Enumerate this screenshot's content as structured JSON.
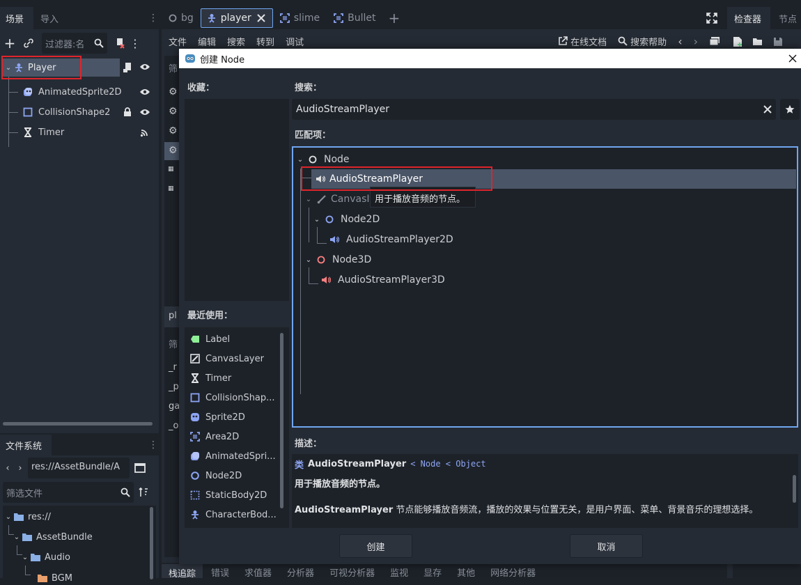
{
  "scene_panel": {
    "tabs": [
      "场景",
      "导入"
    ],
    "filter_placeholder": "过滤器:名",
    "nodes": [
      {
        "label": "Player"
      },
      {
        "label": "AnimatedSprite2D"
      },
      {
        "label": "CollisionShape2"
      },
      {
        "label": "Timer"
      }
    ]
  },
  "filesystem": {
    "title": "文件系统",
    "path": "res://AssetBundle/A",
    "filter_placeholder": "筛选文件",
    "items": [
      {
        "label": "res://"
      },
      {
        "label": "AssetBundle"
      },
      {
        "label": "Audio"
      },
      {
        "label": "BGM"
      }
    ]
  },
  "editor_tabs": [
    "bg",
    "player",
    "slime",
    "Bullet"
  ],
  "menu": {
    "items": [
      "文件",
      "编辑",
      "搜索",
      "转到",
      "调试"
    ],
    "online_docs": "在线文档",
    "search_help": "搜索帮助"
  },
  "right_tabs": [
    "检查器",
    "节点"
  ],
  "script_panel": {
    "filter_label": "筛",
    "partial_label": "pl",
    "filter_label2": "筛",
    "rows": [
      "_r",
      "_p",
      "ga",
      "_o"
    ]
  },
  "bottom_tabs": [
    "栈追踪",
    "错误",
    "求值器",
    "分析器",
    "可视分析器",
    "监视",
    "显存",
    "其他",
    "网络分析器"
  ],
  "dialog": {
    "title": "创建 Node",
    "favorites_label": "收藏：",
    "recent_label": "最近使用：",
    "recent_items": [
      "Label",
      "CanvasLayer",
      "Timer",
      "CollisionShap...",
      "Sprite2D",
      "Area2D",
      "AnimatedSpri...",
      "Node2D",
      "StaticBody2D",
      "CharacterBod..."
    ],
    "search_label": "搜索：",
    "search_value": "AudioStreamPlayer",
    "matches_label": "匹配项：",
    "tree": {
      "root": "Node",
      "selected": "AudioStreamPlayer",
      "canvas": "CanvasIt",
      "node2d": "Node2D",
      "player2d": "AudioStreamPlayer2D",
      "node3d": "Node3D",
      "player3d": "AudioStreamPlayer3D"
    },
    "tooltip": "用于播放音频的节点。",
    "description_label": "描述：",
    "desc_class_prefix": "类",
    "desc_class": "AudioStreamPlayer",
    "desc_inherits": "< Node < Object",
    "desc_brief": "用于播放音频的节点。",
    "desc_full_name": "AudioStreamPlayer",
    "desc_full_text": " 节点能够播放音频流，播放的效果与位置无关，是用户界面、菜单、背景音乐的理想选择。",
    "create_button": "创建",
    "cancel_button": "取消"
  },
  "colors": {
    "accent": "#70a6f0",
    "selection": "#4a5567",
    "node_white": "#e0e0e0",
    "node2d_blue": "#8da5f3",
    "node3d_red": "#fc7f7f",
    "highlight_box": "#e0242b"
  }
}
